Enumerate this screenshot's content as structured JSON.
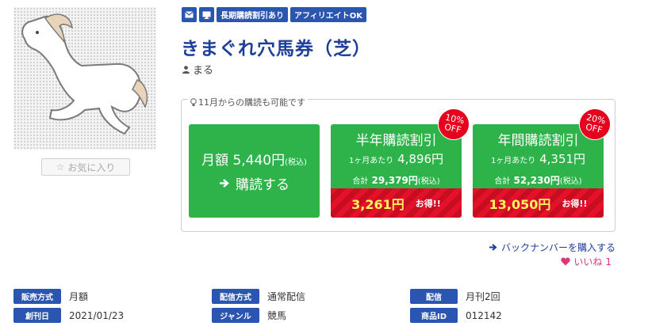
{
  "favorite": {
    "icon": "star-outline-icon",
    "label": "お気に入り"
  },
  "badges": {
    "mail_icon": "envelope-icon",
    "pc_icon": "monitor-icon",
    "long_term": "長期購読割引あり",
    "affiliate": "アフィリエイトOK"
  },
  "title": "きまぐれ穴馬券（芝）",
  "author": {
    "icon": "user-icon",
    "name": "まる"
  },
  "plans": {
    "note": "11月からの購読も可能です",
    "monthly": {
      "price_label": "月額 5,440円",
      "tax": "(税込)",
      "action": "購読する"
    },
    "half_year": {
      "title": "半年購読割引",
      "per_month_label": "1ヶ月あたり",
      "per_month": "4,896円",
      "total_label": "合計",
      "total": "29,379円",
      "tax": "(税込)",
      "savings": "3,261円",
      "savings_label": "お得!!",
      "off_pct": "10%",
      "off": "OFF"
    },
    "yearly": {
      "title": "年間購読割引",
      "per_month_label": "1ヶ月あたり",
      "per_month": "4,351円",
      "total_label": "合計",
      "total": "52,230円",
      "tax": "(税込)",
      "savings": "13,050円",
      "savings_label": "お得!!",
      "off_pct": "20%",
      "off": "OFF"
    }
  },
  "backnumber": "バックナンバーを購入する",
  "like": {
    "label": "いいね",
    "count": "1"
  },
  "info": {
    "sale_method": {
      "label": "販売方式",
      "value": "月額"
    },
    "first_issue": {
      "label": "創刊日",
      "value": "2021/01/23"
    },
    "delivery_method": {
      "label": "配信方式",
      "value": "通常配信"
    },
    "genre": {
      "label": "ジャンル",
      "value": "競馬"
    },
    "delivery": {
      "label": "配信",
      "value": "月刊2回"
    },
    "product_id": {
      "label": "商品ID",
      "value": "012142"
    }
  },
  "colors": {
    "brand": "#1d3f9a",
    "badge": "#2a55b0",
    "green": "#2db34a",
    "red": "#e5102a",
    "accent": "#fff75a",
    "like": "#e0347a"
  }
}
